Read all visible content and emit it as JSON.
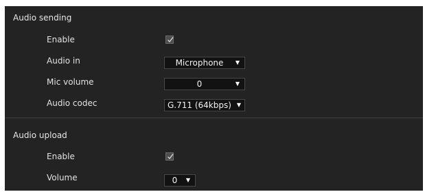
{
  "audio_sending": {
    "title": "Audio sending",
    "enable_label": "Enable",
    "enable_checked": true,
    "audio_in_label": "Audio in",
    "audio_in_value": "Microphone",
    "mic_volume_label": "Mic volume",
    "mic_volume_value": "0",
    "audio_codec_label": "Audio codec",
    "audio_codec_value": "G.711 (64kbps)"
  },
  "audio_upload": {
    "title": "Audio upload",
    "enable_label": "Enable",
    "enable_checked": true,
    "volume_label": "Volume",
    "volume_value": "0"
  },
  "icons": {
    "dropdown": "chevron-down-icon",
    "check": "checkmark-icon"
  },
  "colors": {
    "panel_background": "#232323",
    "select_background": "#121212",
    "text": "#e2e2e2"
  }
}
